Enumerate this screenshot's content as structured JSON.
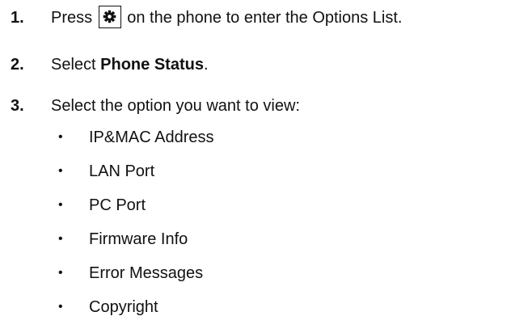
{
  "steps": [
    {
      "number": "1.",
      "before_icon": "Press",
      "icon": "gear-icon",
      "after_icon": "on the phone to enter the Options List."
    },
    {
      "number": "2.",
      "prefix": "Select ",
      "bold": "Phone Status",
      "suffix": "."
    },
    {
      "number": "3.",
      "text": "Select the option you want to view:"
    }
  ],
  "options": [
    "IP&MAC Address",
    "LAN Port",
    "PC Port",
    "Firmware Info",
    "Error Messages",
    "Copyright"
  ],
  "bullet_glyph": "•"
}
